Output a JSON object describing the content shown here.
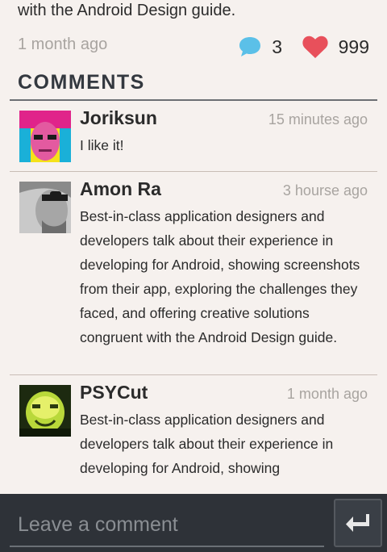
{
  "post": {
    "description_tail": "with the Android Design guide.",
    "time": "1 month ago",
    "comment_count": "3",
    "like_count": "999"
  },
  "section_title": "COMMENTS",
  "comments": [
    {
      "author": "Joriksun",
      "time": "15 minutes ago",
      "text": "I like it!"
    },
    {
      "author": "Amon Ra",
      "time": "3 hourse ago",
      "text": "Best-in-class application designers and developers talk about their experience in developing for Android, showing screenshots from their app, exploring the challenges they faced, and offering creative solutions congruent with the Android Design guide."
    },
    {
      "author": "PSYCut",
      "time": "1 month ago",
      "text": "Best-in-class application designers and developers talk about their experience in developing for Android, showing"
    }
  ],
  "composer": {
    "placeholder": "Leave a comment",
    "value": ""
  },
  "colors": {
    "comment_icon": "#5bc0e8",
    "heart_icon": "#e8505b",
    "background": "#f6f1ee",
    "input_bar": "#2e3238"
  },
  "icons": {
    "comment": "speech-bubble-icon",
    "like": "heart-icon",
    "send": "enter-arrow-icon"
  }
}
